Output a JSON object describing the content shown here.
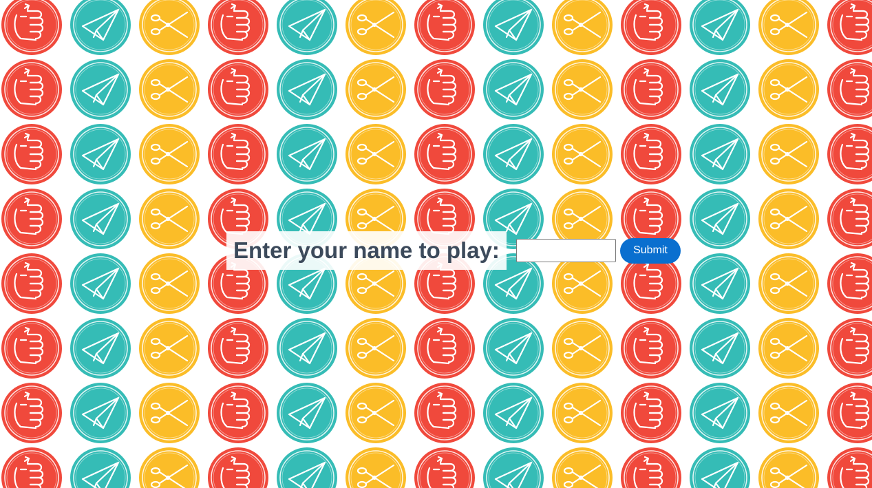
{
  "background": {
    "pattern": [
      "fist-icon",
      "paper-plane-icon",
      "scissors-icon"
    ],
    "colors": {
      "fist": "#f0493c",
      "paper_plane": "#35bcb6",
      "scissors": "#fbbd28"
    }
  },
  "form": {
    "prompt": "Enter your name to play:",
    "name_value": "",
    "name_placeholder": "",
    "submit_label": "Submit"
  },
  "colors": {
    "prompt_text": "#3c4a5b",
    "submit_bg": "#0a6fcf",
    "submit_text": "#ffffff"
  }
}
